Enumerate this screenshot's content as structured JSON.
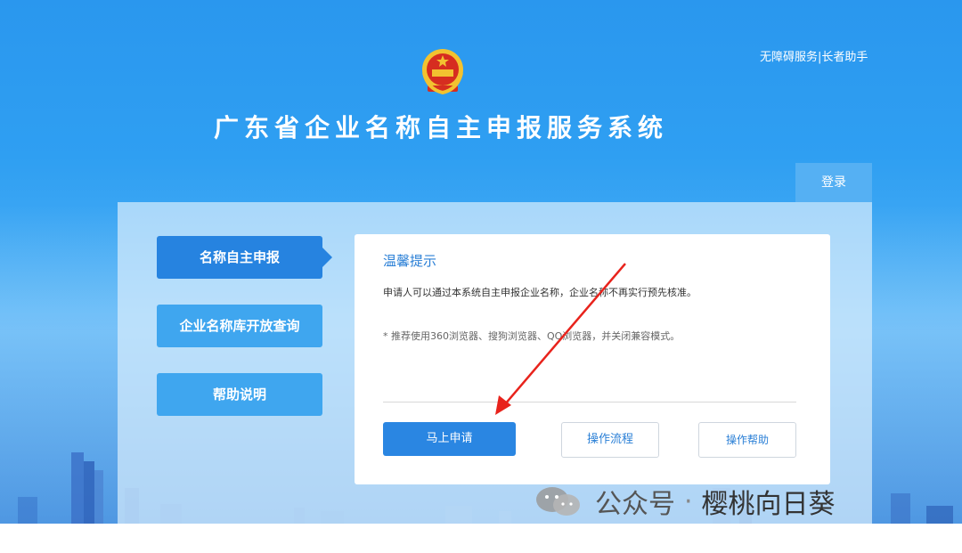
{
  "header": {
    "accessibility_link": "无障碍服务|长者助手",
    "site_title": "广东省企业名称自主申报服务系统",
    "login_tab": "登录"
  },
  "sidebar": {
    "items": [
      {
        "label": "名称自主申报",
        "active": true
      },
      {
        "label": "企业名称库开放查询",
        "active": false
      },
      {
        "label": "帮助说明",
        "active": false
      }
    ]
  },
  "notice": {
    "title": "温馨提示",
    "text1": "申请人可以通过本系统自主申报企业名称，企业名称不再实行预先核准。",
    "text2": "* 推荐使用360浏览器、搜狗浏览器、QQ浏览器，并关闭兼容模式。"
  },
  "actions": {
    "apply_now": "马上申请",
    "process": "操作流程",
    "help": "操作帮助"
  },
  "watermark": {
    "prefix": "公众号",
    "separator": "·",
    "name": "樱桃向日葵"
  },
  "colors": {
    "header_bg": "#2a97ee",
    "primary": "#2683e0",
    "secondary": "#3fa6ef",
    "annotation_arrow": "#e8231c"
  },
  "icons": {
    "emblem": "national-emblem-icon",
    "arrow": "red-annotation-arrow",
    "wechat": "wechat-icon"
  }
}
